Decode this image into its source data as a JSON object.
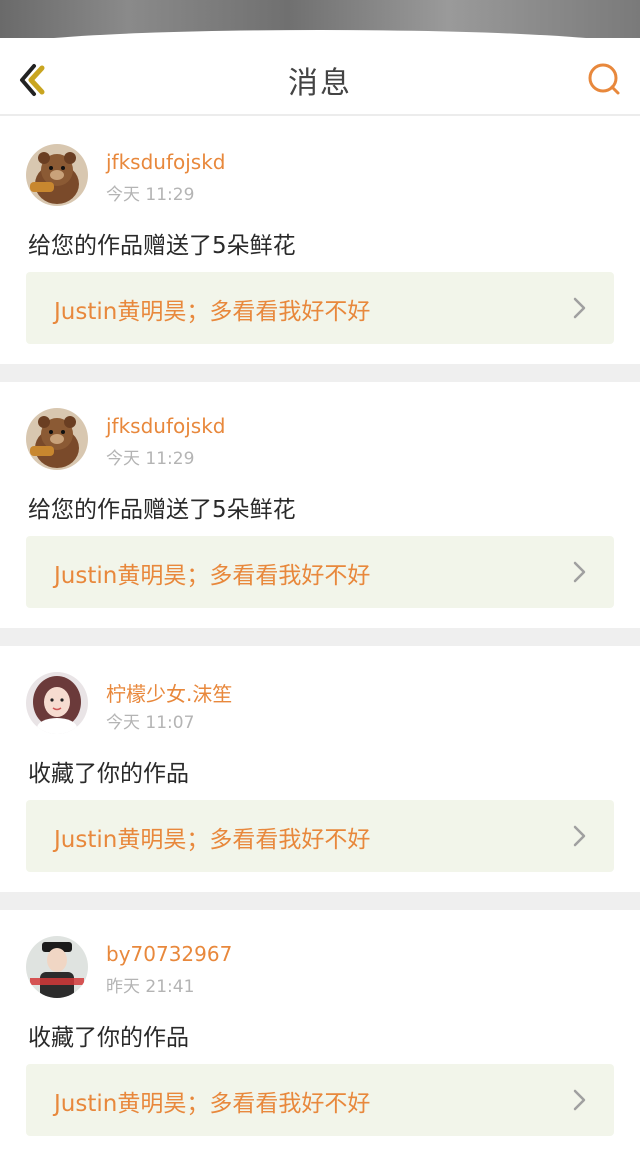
{
  "header": {
    "title": "消息",
    "back_icon": "chevron-left-icon",
    "search_icon": "search-icon"
  },
  "colors": {
    "accent": "#e8883c",
    "back_arrow": "#c9a520",
    "card_link_bg": "#f2f5ea"
  },
  "messages": [
    {
      "username": "jfksdufojskd",
      "time": "今天 11:29",
      "action": "给您的作品赠送了5朵鲜花",
      "work_title": "Justin黄明昊；多看看我好不好",
      "avatar": "teddy-bear-avatar"
    },
    {
      "username": "jfksdufojskd",
      "time": "今天 11:29",
      "action": "给您的作品赠送了5朵鲜花",
      "work_title": "Justin黄明昊；多看看我好不好",
      "avatar": "teddy-bear-avatar"
    },
    {
      "username": "柠檬少女.沫笙",
      "time": "今天 11:07",
      "action": "收藏了你的作品",
      "work_title": "Justin黄明昊；多看看我好不好",
      "avatar": "girl-avatar"
    },
    {
      "username": "by70732967",
      "time": "昨天 21:41",
      "action": "收藏了你的作品",
      "work_title": "Justin黄明昊；多看看我好不好",
      "avatar": "boy-avatar"
    }
  ]
}
